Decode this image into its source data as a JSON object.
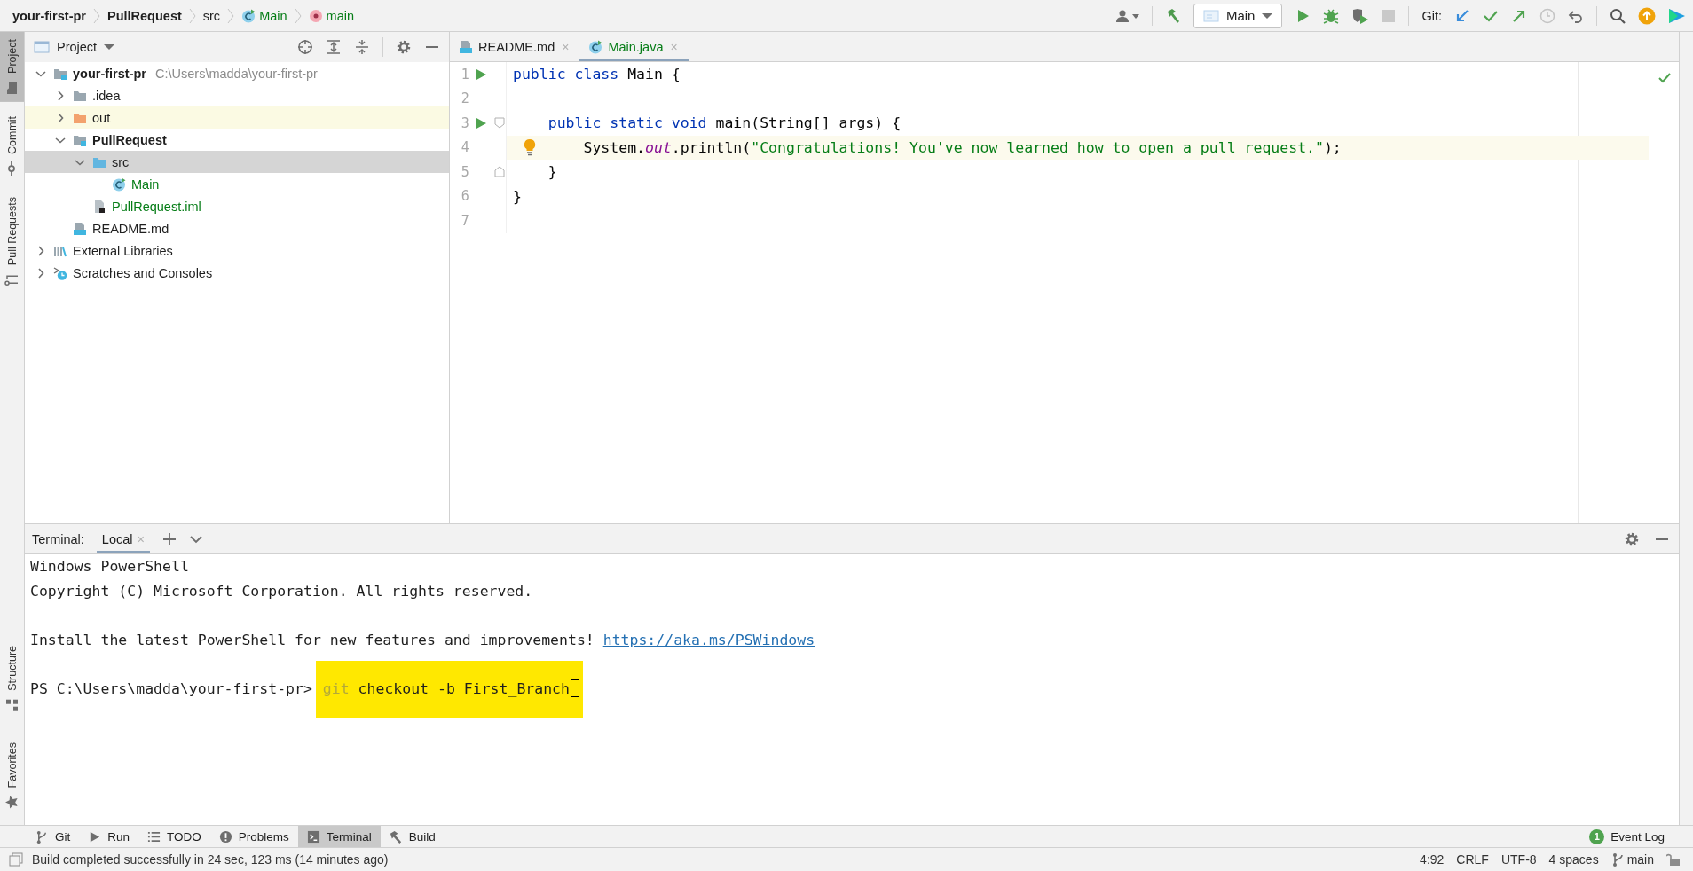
{
  "breadcrumbs": [
    {
      "label": "your-first-pr",
      "kind": "module",
      "added": false
    },
    {
      "label": "PullRequest",
      "kind": "module",
      "added": false
    },
    {
      "label": "src",
      "kind": "folder",
      "added": false
    },
    {
      "label": "Main",
      "kind": "class",
      "added": true
    },
    {
      "label": "main",
      "kind": "method",
      "added": true
    }
  ],
  "toolbar": {
    "run_configuration": "Main",
    "git_label": "Git:"
  },
  "left_stripe": {
    "top": [
      {
        "label": "Project",
        "kind": "project",
        "selected": true
      },
      {
        "label": "Commit",
        "kind": "commit",
        "selected": false
      },
      {
        "label": "Pull Requests",
        "kind": "pull-requests",
        "selected": false
      }
    ],
    "bottom": [
      {
        "label": "Structure",
        "kind": "structure",
        "selected": false
      },
      {
        "label": "Favorites",
        "kind": "favorites",
        "selected": false
      }
    ]
  },
  "project_panel": {
    "title": "Project",
    "tree": [
      {
        "label": "your-first-pr",
        "path": "C:\\Users\\madda\\your-first-pr",
        "kind": "module",
        "added": false,
        "expanded": true,
        "selected": false,
        "highlighted": false,
        "children": [
          {
            "label": ".idea",
            "kind": "folder",
            "added": false,
            "expanded": false,
            "selected": false,
            "highlighted": false
          },
          {
            "label": "out",
            "kind": "excluded-folder",
            "added": false,
            "expanded": false,
            "selected": false,
            "highlighted": true
          },
          {
            "label": "PullRequest",
            "kind": "module",
            "added": false,
            "expanded": true,
            "selected": false,
            "highlighted": false,
            "children": [
              {
                "label": "src",
                "kind": "source-folder",
                "added": false,
                "expanded": true,
                "selected": true,
                "highlighted": false,
                "children": [
                  {
                    "label": "Main",
                    "kind": "class",
                    "added": true,
                    "selected": false,
                    "highlighted": false
                  }
                ]
              },
              {
                "label": "PullRequest.iml",
                "kind": "iml",
                "added": true,
                "selected": false,
                "highlighted": false
              }
            ]
          },
          {
            "label": "README.md",
            "kind": "markdown",
            "added": false,
            "selected": false,
            "highlighted": false
          }
        ]
      },
      {
        "label": "External Libraries",
        "kind": "libraries",
        "added": false,
        "expanded": false,
        "selected": false,
        "highlighted": false
      },
      {
        "label": "Scratches and Consoles",
        "kind": "scratches",
        "added": false,
        "expanded": false,
        "selected": false,
        "highlighted": false
      }
    ]
  },
  "editor": {
    "tabs": [
      {
        "label": "README.md",
        "kind": "markdown",
        "added": false,
        "close": "×",
        "selected": false
      },
      {
        "label": "Main.java",
        "kind": "class",
        "added": true,
        "close": "×",
        "selected": true
      }
    ],
    "lines": [
      {
        "number": "1",
        "run": true,
        "fold_start": false,
        "fold_end": false,
        "bulb": false,
        "current": false,
        "tokens": [
          {
            "text": "public class",
            "kind": "keyword"
          },
          {
            "text": " Main {",
            "kind": "plain"
          }
        ]
      },
      {
        "number": "2",
        "run": false,
        "fold_start": false,
        "fold_end": false,
        "bulb": false,
        "current": false
      },
      {
        "number": "3",
        "run": true,
        "fold_start": true,
        "fold_end": false,
        "bulb": false,
        "current": false,
        "tokens": [
          {
            "text": "    public static void",
            "kind": "keyword"
          },
          {
            "text": " main(String[] args) {",
            "kind": "plain"
          }
        ]
      },
      {
        "number": "4",
        "run": false,
        "fold_start": false,
        "fold_end": false,
        "bulb": true,
        "current": true,
        "tokens": [
          {
            "text": "        System.",
            "kind": "plain"
          },
          {
            "text": "out",
            "kind": "static"
          },
          {
            "text": ".println(",
            "kind": "plain"
          },
          {
            "text": "\"Congratulations! You've now learned how to open a pull request.\"",
            "kind": "string"
          },
          {
            "text": ");",
            "kind": "plain"
          }
        ]
      },
      {
        "number": "5",
        "run": false,
        "fold_start": false,
        "fold_end": true,
        "bulb": false,
        "current": false,
        "tokens": [
          {
            "text": "    }",
            "kind": "plain"
          }
        ]
      },
      {
        "number": "6",
        "run": false,
        "fold_start": false,
        "fold_end": false,
        "bulb": false,
        "current": false,
        "tokens": [
          {
            "text": "}",
            "kind": "plain"
          }
        ]
      },
      {
        "number": "7",
        "run": false,
        "fold_start": false,
        "fold_end": false,
        "bulb": false,
        "current": false
      }
    ]
  },
  "terminal": {
    "title": "Terminal:",
    "tabs": [
      {
        "label": "Local",
        "close": "×",
        "selected": true
      }
    ],
    "lines": [
      {
        "spaced": false,
        "segments": [
          {
            "text": "Windows PowerShell",
            "kind": "output"
          }
        ]
      },
      {
        "spaced": false,
        "segments": [
          {
            "text": "Copyright (C) Microsoft Corporation. All rights reserved.",
            "kind": "output"
          }
        ]
      },
      {
        "spaced": true,
        "segments": [
          {
            "text": "Install the latest PowerShell for new features and improvements!",
            "kind": "output"
          },
          {
            "text": "https://aka.ms/PSWindows",
            "kind": "link"
          }
        ]
      },
      {
        "spaced": true,
        "highlighted": true,
        "cursor": true,
        "segments": [
          {
            "text": "PS C:\\Users\\madda\\your-first-pr>",
            "kind": "prompt"
          },
          {
            "text": "git",
            "kind": "faint"
          },
          {
            "text": "checkout -b First_Branch",
            "kind": "command"
          }
        ]
      }
    ]
  },
  "tool_windows": [
    {
      "label": "Git",
      "kind": "git",
      "selected": false
    },
    {
      "label": "Run",
      "kind": "run",
      "selected": false
    },
    {
      "label": "TODO",
      "kind": "todo",
      "selected": false
    },
    {
      "label": "Problems",
      "kind": "problems",
      "selected": false
    },
    {
      "label": "Terminal",
      "kind": "terminal",
      "selected": true
    },
    {
      "label": "Build",
      "kind": "build",
      "selected": false
    }
  ],
  "event_log": {
    "count": "1",
    "label": "Event Log"
  },
  "status_bar": {
    "message": "Build completed successfully in 24 sec, 123 ms (14 minutes ago)",
    "position": "4:92",
    "line_separator": "CRLF",
    "encoding": "UTF-8",
    "indent": "4 spaces",
    "branch": "main"
  }
}
